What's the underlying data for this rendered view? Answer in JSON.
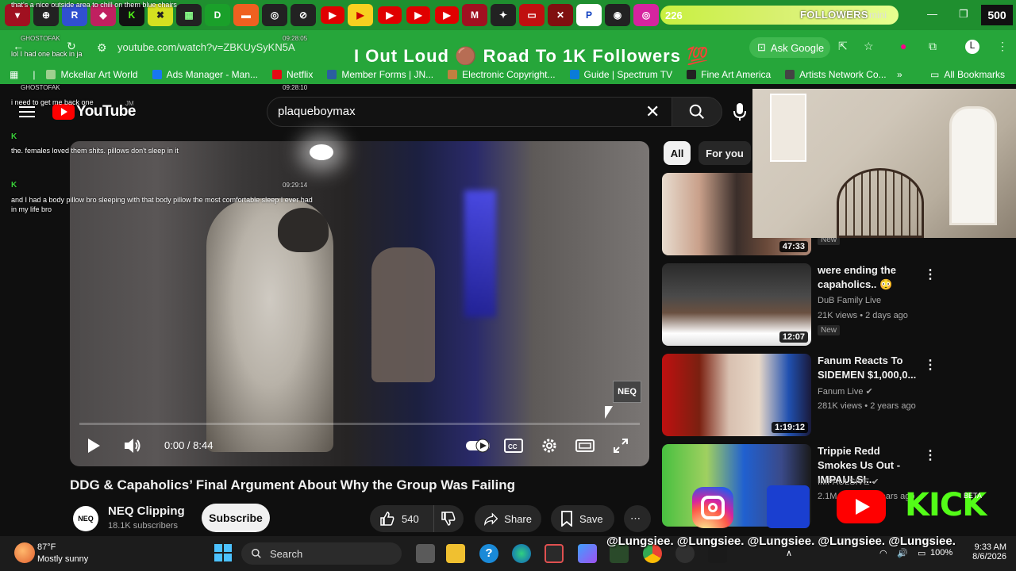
{
  "browser": {
    "tab_count": "226",
    "followers_label": "FOLLOWERS",
    "gemini_label": "mini",
    "follower_number": "500",
    "url": "youtube.com/watch?v=ZBKUySyKN5A",
    "banner": "I Out Loud 🟤 Road To 1K Followers 💯",
    "ask_google": "Ask Google"
  },
  "bookmarks": [
    {
      "label": "Mckellar Art World",
      "color": "#9fd08f"
    },
    {
      "label": "Ads Manager - Man...",
      "color": "#1877f2"
    },
    {
      "label": "Netflix",
      "color": "#e50914"
    },
    {
      "label": "Member Forms | JN...",
      "color": "#2b5fa0"
    },
    {
      "label": "Electronic Copyright...",
      "color": "#c08040"
    },
    {
      "label": "Guide | Spectrum TV",
      "color": "#0a7cd8"
    },
    {
      "label": "Fine Art America",
      "color": "#222222"
    },
    {
      "label": "Artists Network Co...",
      "color": "#444444"
    }
  ],
  "all_bookmarks": "All Bookmarks",
  "chat": {
    "line_top": "that's a nice outside area to chill on them blue chairs",
    "user1": "GHOSTOFAK",
    "time1": "09:28:05",
    "msg1": "lol I had one back in ja",
    "user2": "GHOSTOFAK",
    "time2": "09:28:10",
    "msg2": "i need to get me back one",
    "msg3": "the. females loved them shits. pillows don't sleep in it",
    "time3": "09:29:14",
    "msg4": "and I had a body pillow bro sleeping with that body pillow the most comfortable sleep I ever had in my life bro"
  },
  "youtube": {
    "logo": "YouTube",
    "country": "JM",
    "search_query": "plaqueboymax",
    "video_time": "0:00 / 8:44",
    "watermark": "NEQ",
    "progress_fraction": 0.0,
    "title": "DDG & Capaholics’ Final Argument About Why the Group Was Failing",
    "channel_name": "NEQ Clipping",
    "channel_subs": "18.1K subscribers",
    "channel_avatar": "NEQ",
    "subscribe": "Subscribe",
    "likes": "540",
    "share": "Share",
    "save": "Save"
  },
  "chips": [
    {
      "label": "All",
      "active": true
    },
    {
      "label": "For you",
      "active": false
    }
  ],
  "recommendations": [
    {
      "title": "",
      "channel": "",
      "meta": "",
      "badge": "New",
      "duration": "47:33"
    },
    {
      "title": "were ending the capaholics.. 😳",
      "channel": "DuB Family Live",
      "meta": "21K views • 2 days ago",
      "badge": "New",
      "duration": "12:07"
    },
    {
      "title": "Fanum Reacts To SIDEMEN $1,000,0...",
      "channel": "Fanum Live ✔",
      "meta": "281K views • 2 years ago",
      "badge": "",
      "duration": "1:19:12"
    },
    {
      "title": "Trippie Redd Smokes Us Out - IMPAULSI...",
      "channel": "IMPAULSIVE ✔",
      "meta": "2.1M views • 2 years ago",
      "badge": "",
      "duration": ""
    }
  ],
  "overlay": {
    "handles": "@Lungsiee. @Lungsiee. @Lungsiee. @Lungsiee. @Lungsiee.",
    "kick": "KICK",
    "beta": "BETA"
  },
  "taskbar": {
    "temp": "87°F",
    "weather": "Mostly sunny",
    "search": "Search",
    "battery": "100%",
    "time": "9:33 AM",
    "date": "8/6/2026"
  }
}
